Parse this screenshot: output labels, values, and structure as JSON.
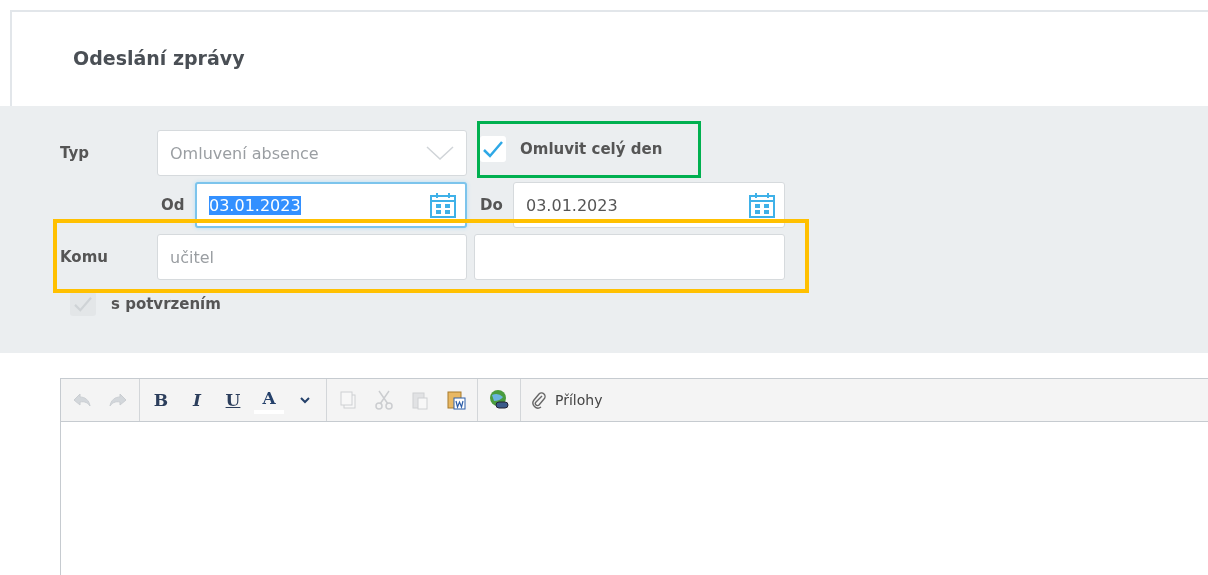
{
  "header": {
    "title": "Odeslání zprávy"
  },
  "form": {
    "type": {
      "label": "Typ",
      "value": "Omluvení absence"
    },
    "whole_day": {
      "label": "Omluvit celý den",
      "checked": true
    },
    "from": {
      "label": "Od",
      "value": "03.01.2023",
      "selected": true
    },
    "to": {
      "label": "Do",
      "value": "03.01.2023",
      "selected": false
    },
    "recipient": {
      "label": "Komu",
      "placeholder": "učitel"
    },
    "confirmation": {
      "label": "s potvrzením",
      "checked": true,
      "disabled": true
    }
  },
  "annotations": [
    {
      "color": "#00b050"
    },
    {
      "color": "#ffc000"
    }
  ],
  "toolbar": [
    [
      {
        "kind": "undo",
        "disabled": true
      },
      {
        "kind": "redo",
        "disabled": true
      }
    ],
    [
      {
        "kind": "bold",
        "label": "B",
        "disabled": false
      },
      {
        "kind": "italic",
        "label": "I",
        "disabled": false
      },
      {
        "kind": "underline",
        "label": "U",
        "disabled": false
      },
      {
        "kind": "color",
        "label": "A",
        "disabled": false
      },
      {
        "kind": "caret",
        "disabled": false
      }
    ],
    [
      {
        "kind": "copy",
        "disabled": true
      },
      {
        "kind": "cut",
        "disabled": true
      },
      {
        "kind": "paste",
        "disabled": true
      },
      {
        "kind": "paste-word",
        "disabled": false
      }
    ],
    [
      {
        "kind": "link",
        "disabled": false
      }
    ],
    [
      {
        "kind": "attach",
        "label": "Přílohy",
        "disabled": false
      }
    ]
  ]
}
